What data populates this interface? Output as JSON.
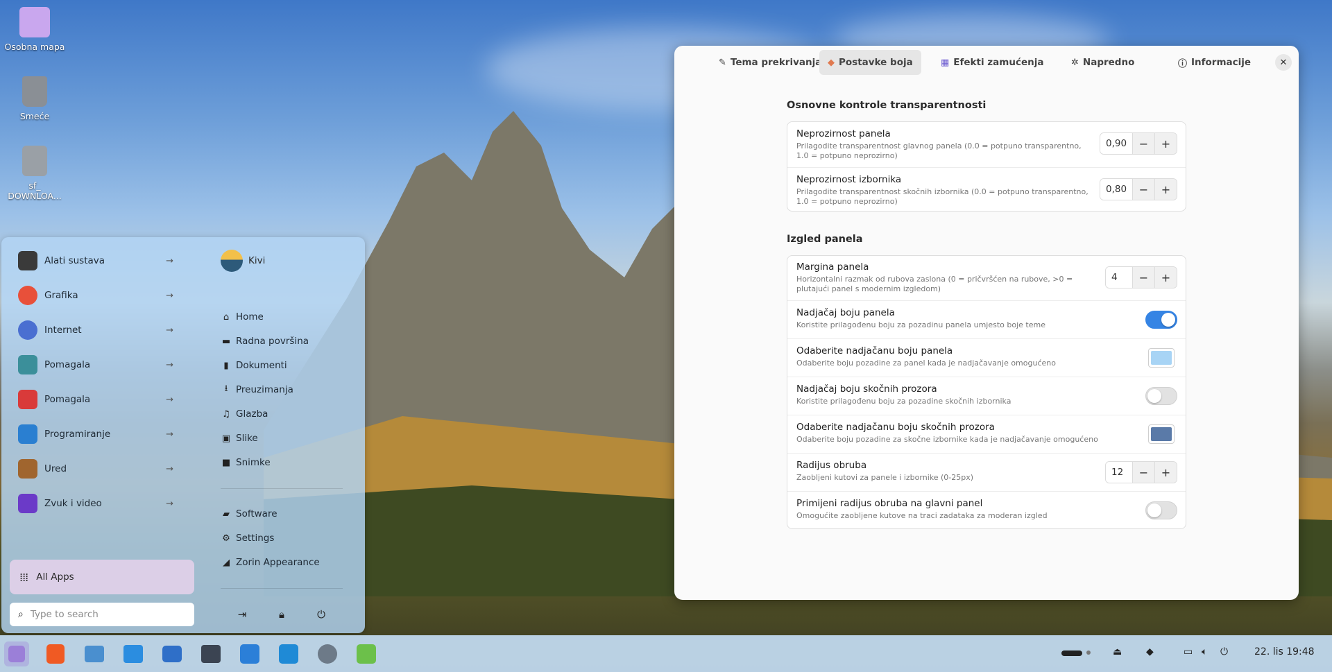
{
  "desktop": {
    "icons": [
      {
        "label": "Osobna mapa",
        "icon": "home-folder-icon"
      },
      {
        "label": "Smeće",
        "icon": "trash-icon"
      },
      {
        "label": "sf_\nDOWNLOA...",
        "line1": "sf_",
        "line2": "DOWNLOA...",
        "icon": "drive-icon"
      }
    ]
  },
  "start_menu": {
    "categories": [
      {
        "label": "Alati sustava",
        "icon": "system-tools-icon",
        "color": "#3a3a3a"
      },
      {
        "label": "Grafika",
        "icon": "graphics-icon",
        "color": "#e8503a"
      },
      {
        "label": "Internet",
        "icon": "internet-icon",
        "color": "#4a6fd1"
      },
      {
        "label": "Pomagala",
        "icon": "accessories-icon",
        "color": "#3b8f9a"
      },
      {
        "label": "Pomagala",
        "icon": "toolbox-icon",
        "color": "#d93a3a"
      },
      {
        "label": "Programiranje",
        "icon": "programming-icon",
        "color": "#2a7fd1"
      },
      {
        "label": "Ured",
        "icon": "office-icon",
        "color": "#a0652e"
      },
      {
        "label": "Zvuk i video",
        "icon": "sound-video-icon",
        "color": "#6b3ac8"
      }
    ],
    "user": {
      "name": "Kivi"
    },
    "places": [
      {
        "label": "Home",
        "icon": "home-icon"
      },
      {
        "label": "Radna površina",
        "icon": "desktop-icon"
      },
      {
        "label": "Dokumenti",
        "icon": "documents-icon"
      },
      {
        "label": "Preuzimanja",
        "icon": "download-icon"
      },
      {
        "label": "Glazba",
        "icon": "music-icon"
      },
      {
        "label": "Slike",
        "icon": "pictures-icon"
      },
      {
        "label": "Snimke",
        "icon": "videos-icon"
      }
    ],
    "system": [
      {
        "label": "Software",
        "icon": "software-icon"
      },
      {
        "label": "Settings",
        "icon": "settings-icon"
      },
      {
        "label": "Zorin Appearance",
        "icon": "appearance-icon"
      }
    ],
    "all_apps_label": "All Apps",
    "search_placeholder": "Type to search"
  },
  "taskbar": {
    "apps": [
      {
        "name": "zorin-menu-icon",
        "color": "#9b7fd8"
      },
      {
        "name": "brave-icon",
        "color": "#f05a23"
      },
      {
        "name": "files-icon",
        "color": "#4a8fcf"
      },
      {
        "name": "store-icon",
        "color": "#2b8de0"
      },
      {
        "name": "chat-icon",
        "color": "#2f6fc8"
      },
      {
        "name": "terminal-icon",
        "color": "#3b4452"
      },
      {
        "name": "extensions-icon",
        "color": "#2b7fd8"
      },
      {
        "name": "vscode-icon",
        "color": "#1f8ad6"
      },
      {
        "name": "settings-gear-icon",
        "color": "#6d7a88"
      },
      {
        "name": "extension-green-icon",
        "color": "#6cc04a"
      }
    ],
    "clock": "22. lis 19:48"
  },
  "window": {
    "tabs": [
      {
        "label": "Tema prekrivanja",
        "icon": "theme-icon"
      },
      {
        "label": "Postavke boja",
        "icon": "palette-icon"
      },
      {
        "label": "Efekti zamućenja",
        "icon": "blur-icon"
      },
      {
        "label": "Napredno",
        "icon": "advanced-icon"
      },
      {
        "label": "Informacije",
        "icon": "info-icon"
      }
    ],
    "active_tab": "Postavke boja",
    "section1": {
      "title": "Osnovne kontrole transparentnosti",
      "rows": [
        {
          "title": "Neprozirnost panela",
          "subtitle": "Prilagodite transparentnost glavnog panela (0.0 = potpuno transparentno, 1.0 = potpuno neprozirno)",
          "value": "0,90"
        },
        {
          "title": "Neprozirnost izbornika",
          "subtitle": "Prilagodite transparentnost skočnih izbornika (0.0 = potpuno transparentno, 1.0 = potpuno neprozirno)",
          "value": "0,80"
        }
      ]
    },
    "section2": {
      "title": "Izgled panela",
      "rows": [
        {
          "title": "Margina panela",
          "subtitle": "Horizontalni razmak od rubova zaslona (0 = pričvršćen na rubove, >0 = plutajući panel s modernim izgledom)",
          "value": "4"
        },
        {
          "title": "Nadjačaj boju panela",
          "subtitle": "Koristite prilagođenu boju za pozadinu panela umjesto boje teme",
          "toggle": true
        },
        {
          "title": "Odaberite nadjačanu boju panela",
          "subtitle": "Odaberite boju pozadine za panel kada je nadjačavanje omogućeno",
          "color": "#a8d4f5"
        },
        {
          "title": "Nadjačaj boju skočnih prozora",
          "subtitle": "Koristite prilagođenu boju za pozadine skočnih izbornika",
          "toggle": false
        },
        {
          "title": "Odaberite nadjačanu boju skočnih prozora",
          "subtitle": "Odaberite boju pozadine za skočne izbornike kada je nadjačavanje omogućeno",
          "color": "#5a7aa8"
        },
        {
          "title": "Radijus obruba",
          "subtitle": "Zaobljeni kutovi za panele i izbornike (0-25px)",
          "value": "12"
        },
        {
          "title": "Primijeni radijus obruba na glavni panel",
          "subtitle": "Omogućite zaobljene kutove na traci zadataka za moderan izgled",
          "toggle": false
        }
      ]
    }
  }
}
